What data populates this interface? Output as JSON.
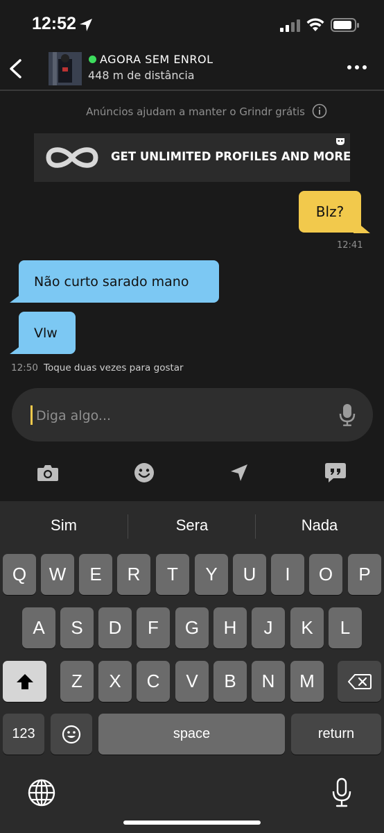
{
  "status_bar": {
    "time": "12:52"
  },
  "header": {
    "contact_name": "AGORA SEM ENROL",
    "distance": "448 m de distância",
    "online_color": "#3ddc5d"
  },
  "ads": {
    "notice": "Anúncios ajudam a manter o Grindr grátis",
    "banner_text": "GET UNLIMITED PROFILES AND MORE"
  },
  "messages": {
    "sent": [
      {
        "text": "Blz?",
        "time": "12:41"
      }
    ],
    "received": [
      {
        "text": "Não curto sarado mano"
      },
      {
        "text": "Vlw"
      }
    ],
    "last_time": "12:50",
    "double_tap_hint": "Toque duas vezes para gostar"
  },
  "composer": {
    "placeholder": "Diga algo..."
  },
  "toolbar_icons": [
    "camera-icon",
    "emoji-icon",
    "location-icon",
    "saved-phrases-icon"
  ],
  "keyboard": {
    "suggestions": [
      "Sim",
      "Sera",
      "Nada"
    ],
    "row1": [
      "Q",
      "W",
      "E",
      "R",
      "T",
      "Y",
      "U",
      "I",
      "O",
      "P"
    ],
    "row2": [
      "A",
      "S",
      "D",
      "F",
      "G",
      "H",
      "J",
      "K",
      "L"
    ],
    "row3": [
      "Z",
      "X",
      "C",
      "V",
      "B",
      "N",
      "M"
    ],
    "numbers_key": "123",
    "space_key": "space",
    "return_key": "return"
  },
  "colors": {
    "background": "#1a1a1a",
    "sent_bubble": "#f2c94c",
    "received_bubble": "#7cc8f3",
    "keyboard": "#2b2b2b"
  }
}
